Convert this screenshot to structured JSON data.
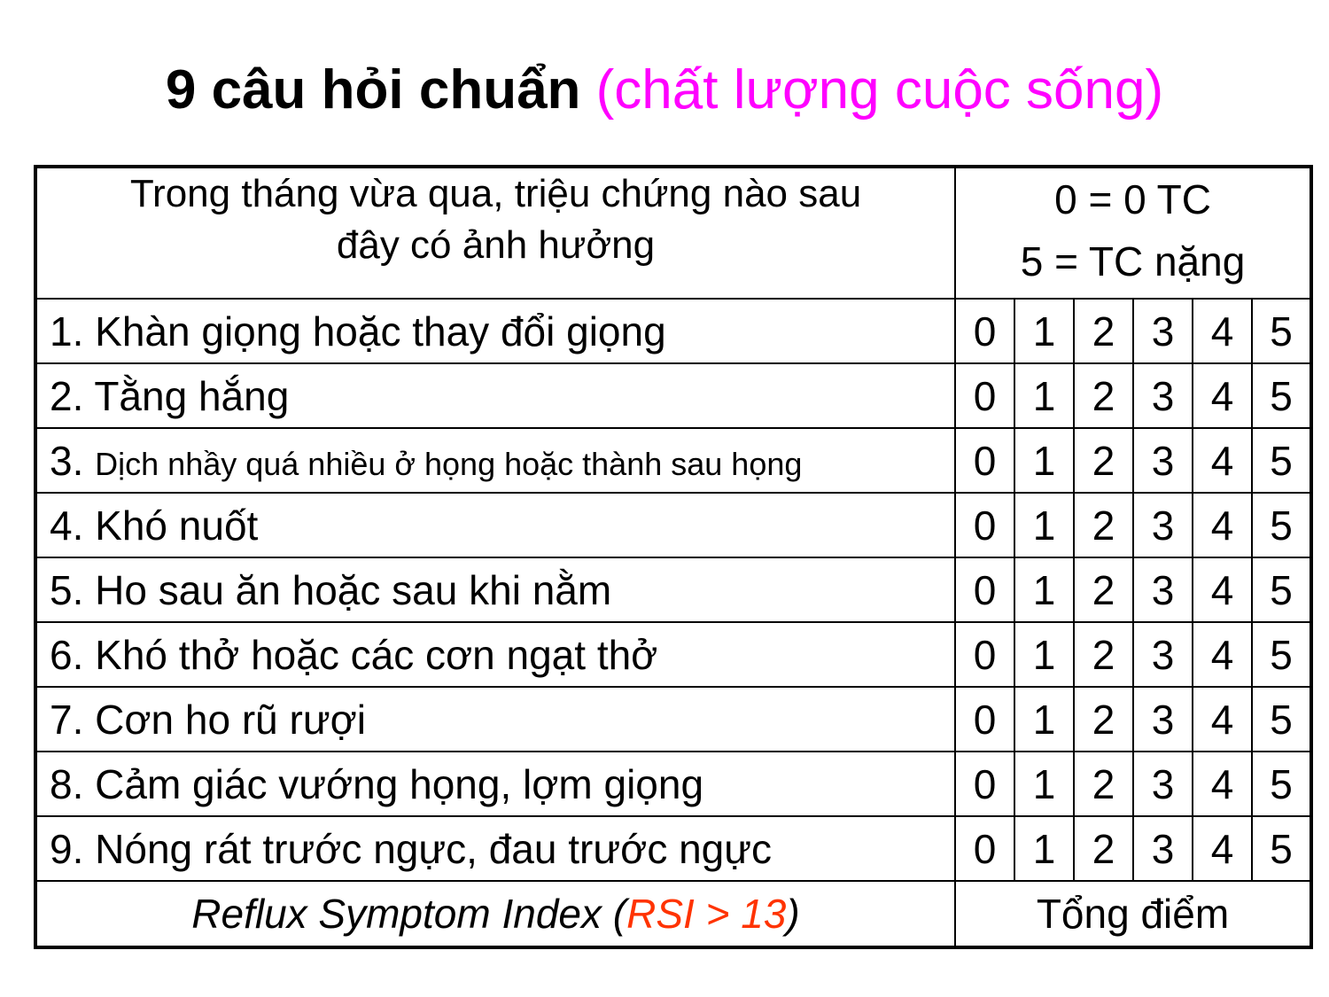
{
  "title": {
    "main": "9 câu hỏi chuẩn",
    "sub": "(chất lượng cuộc sống)"
  },
  "colors": {
    "title_sub": "#ff00ff",
    "rsi_accent": "#ff3300"
  },
  "table": {
    "header": {
      "question_line1": "Trong tháng vừa qua, triệu chứng nào sau",
      "question_line2": "đây có ảnh hưởng",
      "scale_line1": "0 = 0 TC",
      "scale_line2": "5 = TC nặng"
    },
    "scores": [
      "0",
      "1",
      "2",
      "3",
      "4",
      "5"
    ],
    "questions": [
      {
        "number": "1.",
        "text": "Khàn giọng hoặc thay đổi giọng"
      },
      {
        "number": "2.",
        "text": "Tằng hắng"
      },
      {
        "number": "3.",
        "text": "Dịch nhầy quá nhiều ở họng hoặc thành sau họng"
      },
      {
        "number": "4.",
        "text": "Khó nuốt"
      },
      {
        "number": "5.",
        "text": "Ho sau ăn hoặc sau khi nằm"
      },
      {
        "number": "6.",
        "text": "Khó thở hoặc các cơn ngạt thở"
      },
      {
        "number": "7.",
        "text": "Cơn ho rũ rượi"
      },
      {
        "number": "8.",
        "text": "Cảm giác vướng họng, lợm giọng"
      },
      {
        "number": "9.",
        "text": "Nóng rát trước ngực, đau trước ngực"
      }
    ],
    "footer": {
      "index_prefix": "Reflux Symptom Index (",
      "index_accent": "RSI > 13",
      "index_suffix": ")",
      "total": "Tổng điểm"
    }
  }
}
